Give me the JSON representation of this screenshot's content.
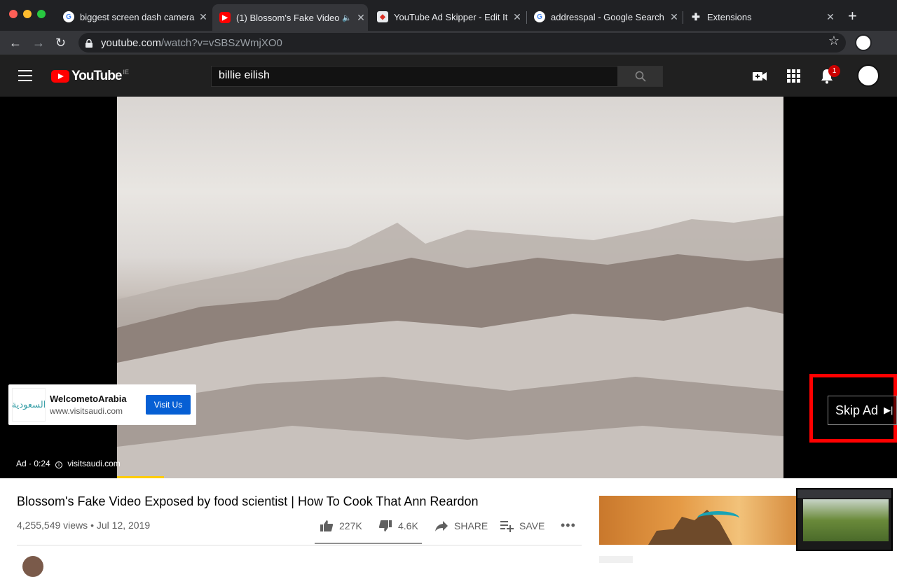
{
  "browser": {
    "tabs": [
      {
        "title": "biggest screen dash camera",
        "active": false,
        "favicon": "google-icon"
      },
      {
        "title": "(1) Blossom's Fake Video",
        "active": true,
        "favicon": "youtube-icon",
        "audio": true
      },
      {
        "title": "YouTube Ad Skipper - Edit It",
        "active": false,
        "favicon": "extension-store-icon"
      },
      {
        "title": "addresspal - Google Search",
        "active": false,
        "favicon": "google-icon"
      },
      {
        "title": "Extensions",
        "active": false,
        "favicon": "puzzle-icon"
      }
    ],
    "url_host": "youtube.com",
    "url_path": "/watch?v=vSBSzWmjXO0"
  },
  "youtube": {
    "logo_text": "YouTube",
    "country_code": "IE",
    "search_value": "billie eilish",
    "notification_count": "1"
  },
  "ad": {
    "title": "WelcometoArabia",
    "url": "www.visitsaudi.com",
    "button": "Visit Us",
    "logo_text": "السعودية",
    "info_label": "Ad · 0:24",
    "info_url": "visitsaudi.com",
    "skip_label": "Skip Ad",
    "progress_fraction": 0.07
  },
  "video": {
    "title": "Blossom's Fake Video Exposed by food scientist | How To Cook That Ann Reardon",
    "views": "4,255,549 views",
    "date": "Jul 12, 2019",
    "likes": "227K",
    "dislikes": "4.6K",
    "share": "SHARE",
    "save": "SAVE"
  },
  "colors": {
    "accent_red": "#ff0000",
    "progress_yellow": "#ffcc00",
    "visit_blue": "#065fd4"
  }
}
